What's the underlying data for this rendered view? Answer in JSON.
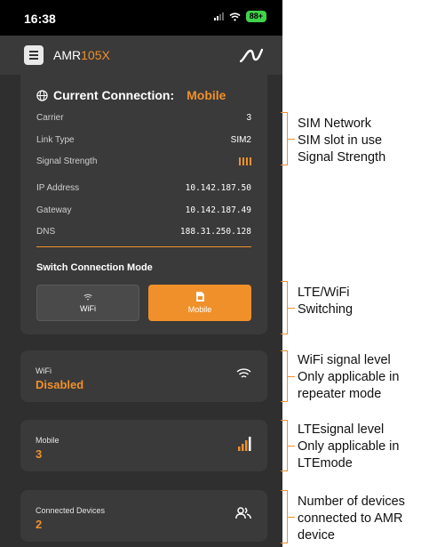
{
  "status_bar": {
    "time": "16:38",
    "battery": "88+"
  },
  "app_bar": {
    "title_prefix": "AMR",
    "title_accent": "105X"
  },
  "connection": {
    "header": "Current Connection:",
    "mode": "Mobile",
    "rows": [
      {
        "label": "Carrier",
        "value": "3"
      },
      {
        "label": "Link Type",
        "value": "SIM2"
      },
      {
        "label": "Signal Strength",
        "value_level": 4
      }
    ],
    "network": [
      {
        "label": "IP Address",
        "value": "10.142.187.50"
      },
      {
        "label": "Gateway",
        "value": "10.142.187.49"
      },
      {
        "label": "DNS",
        "value": "188.31.250.128"
      }
    ],
    "switch_title": "Switch Connection Mode",
    "wifi_button": "WiFi",
    "mobile_button": "Mobile"
  },
  "cards": {
    "wifi": {
      "label": "WiFi",
      "value": "Disabled",
      "icon": "wifi-icon"
    },
    "mobile": {
      "label": "Mobile",
      "value": "3",
      "icon": "signal-bars-icon"
    },
    "devices": {
      "label": "Connected Devices",
      "value": "2",
      "icon": "users-icon"
    }
  },
  "annotations": {
    "sim": [
      "SIM Network",
      "SIM slot in use",
      "Signal Strength"
    ],
    "switching": [
      "LTE/WiFi",
      "Switching"
    ],
    "wifi": [
      "WiFi signal level",
      "Only applicable in",
      "repeater mode"
    ],
    "lte": [
      "LTEsignal level",
      "Only applicable in",
      "LTEmode"
    ],
    "devices": [
      "Number of devices",
      "connected to AMR",
      "device"
    ]
  },
  "colors": {
    "accent": "#f0902a",
    "background": "#2f2f2f",
    "card": "#3a3a3a"
  }
}
